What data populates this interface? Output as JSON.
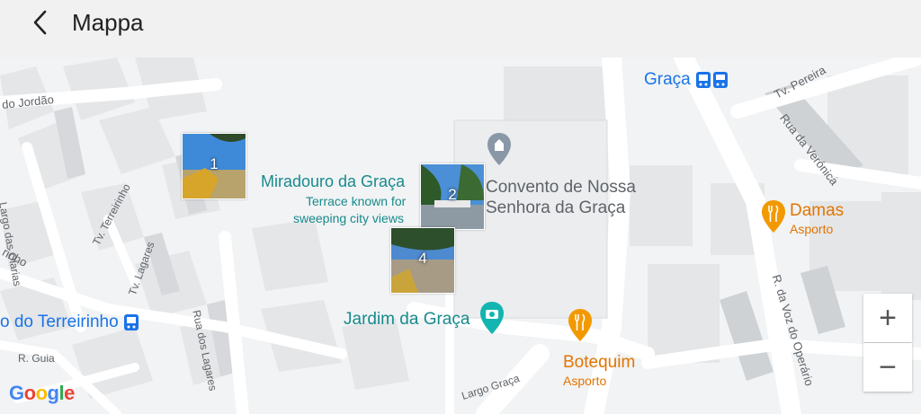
{
  "header": {
    "title": "Mappa",
    "back_icon": "back-arrow-icon"
  },
  "map": {
    "places": {
      "miradouro_name": "Miradouro da Graça",
      "miradouro_desc_1": "Terrace known for",
      "miradouro_desc_2": "sweeping city views",
      "convento_1": "Convento de Nossa",
      "convento_2": "Senhora da Graça",
      "jardim": "Jardim da Graça",
      "damas": "Damas",
      "damas_sub": "Asporto",
      "botequim": "Botequim",
      "botequim_sub": "Asporto",
      "graca": "Graça",
      "terreirinho": "o do Terreirinho"
    },
    "streets": {
      "jordao": "do Jordão",
      "olarias": "Largo das Olarias",
      "terreirinho": "Tv. Terreirinho",
      "lagares_tv": "Tv. Lagares",
      "inho": "rinho",
      "rua_lagares": "Rua dos Lagares",
      "guia": "R. Guia",
      "largo_graca": "Largo Graça",
      "pereira": "Tv. Pereira",
      "veronica": "Rua da Verónica",
      "voz_operario": "R. da Voz do Operário"
    },
    "photos": [
      {
        "number": "1"
      },
      {
        "number": "2"
      },
      {
        "number": "4"
      }
    ],
    "zoom": {
      "in": "+",
      "out": "−"
    },
    "attribution": {
      "g1": "G",
      "o1": "o",
      "o2": "o",
      "g2": "g",
      "l": "l",
      "e": "e"
    },
    "colors": {
      "teal": "#188a8d",
      "orange": "#e37400",
      "blue": "#1a73e8",
      "gray": "#5f6368"
    }
  }
}
